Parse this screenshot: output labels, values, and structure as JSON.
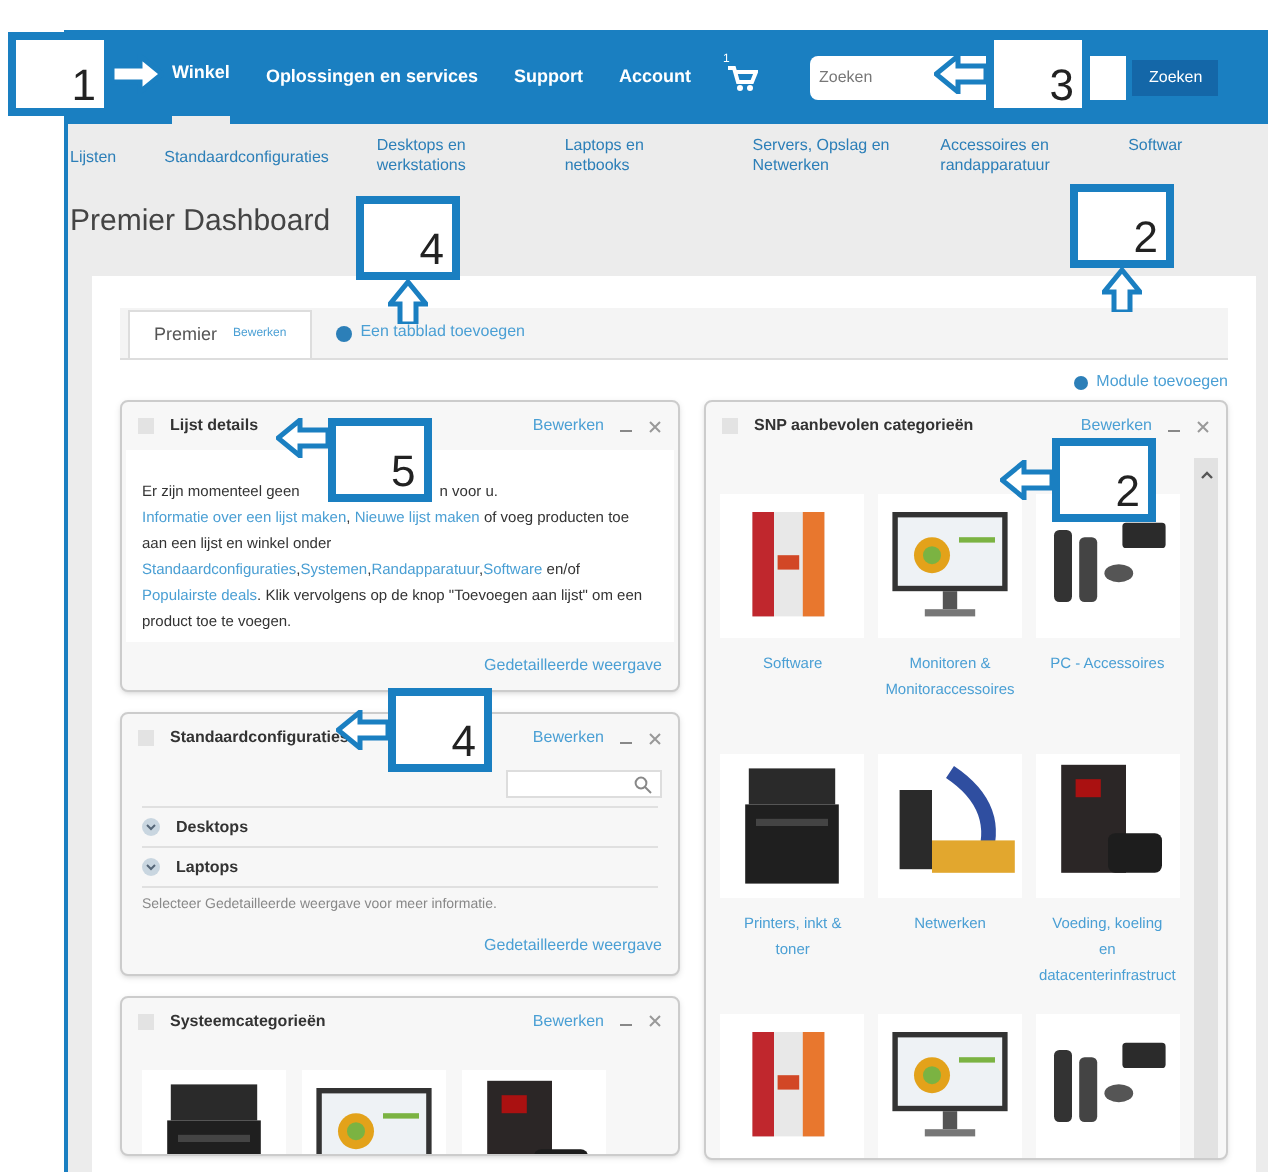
{
  "nav": {
    "items": [
      {
        "label": "Winkel",
        "selected": true
      },
      {
        "label": "Oplossingen en services",
        "selected": false
      },
      {
        "label": "Support",
        "selected": false
      },
      {
        "label": "Account",
        "selected": false
      }
    ],
    "cart_count": "1",
    "search": {
      "placeholder": "Zoeken",
      "button": "Zoeken"
    }
  },
  "subnav": [
    "Lijsten",
    "Standaardconfiguraties",
    "Desktops en werkstations",
    "Laptops en netbooks",
    "Servers, Opslag en Netwerken",
    "Accessoires en randapparatuur",
    "Softwar"
  ],
  "page_title": "Premier Dashboard",
  "tabs": [
    {
      "label": "Premier",
      "edit": "Bewerken",
      "selected": true
    }
  ],
  "add_tab": "Een tabblad toevoegen",
  "add_module": "Module toevoegen",
  "lijst_details": {
    "title": "Lijst details",
    "edit": "Bewerken",
    "text_start": "Er zijn momenteel geen",
    "text_after_callout": "n voor u.",
    "links_1": [
      "Informatie over een lijst maken",
      "Nieuwe lijst maken"
    ],
    "separator_1": ",",
    "separator_2": ",",
    "text_2": "of voeg producten toe aan een lijst en winkel onder",
    "links_2": [
      "Standaardconfiguraties",
      "Systemen",
      "Randapparatuur",
      "Software"
    ],
    "text_3": "en/of",
    "link_3": "Populairste deals",
    "text_4": ". Klik vervolgens op de knop \"Toevoegen aan lijst\" om een product toe te voegen.",
    "footer_link": "Gedetailleerde weergave"
  },
  "standaard": {
    "title": "Standaardconfiguraties",
    "edit": "Bewerken",
    "items": [
      {
        "label": "Desktops",
        "expanded": false
      },
      {
        "label": "Laptops",
        "expanded": false
      }
    ],
    "hint": "Selecteer Gedetailleerde weergave voor meer informatie.",
    "footer_link": "Gedetailleerde weergave"
  },
  "systeem": {
    "title": "Systeemcategorieën",
    "edit": "Bewerken"
  },
  "snp": {
    "title": "SNP aanbevolen categorieën",
    "edit": "Bewerken",
    "categories": [
      {
        "lines": [
          "Software"
        ]
      },
      {
        "lines": [
          "Monitoren &",
          "Monitoraccessoires"
        ]
      },
      {
        "lines": [
          "PC - Accessoires"
        ]
      },
      {
        "lines": [
          "Printers, inkt &",
          "toner"
        ]
      },
      {
        "lines": [
          "Netwerken"
        ]
      },
      {
        "lines": [
          "Voeding, koeling",
          "en",
          "datacenterinfrastruct"
        ]
      }
    ]
  },
  "callouts": [
    {
      "number": "1",
      "kind": "right"
    },
    {
      "number": "3",
      "kind": "left"
    },
    {
      "number": "4",
      "kind": "up"
    },
    {
      "number": "2",
      "kind": "up"
    },
    {
      "number": "5",
      "kind": "left"
    },
    {
      "number": "2",
      "kind": "left"
    },
    {
      "number": "4",
      "kind": "left"
    }
  ]
}
